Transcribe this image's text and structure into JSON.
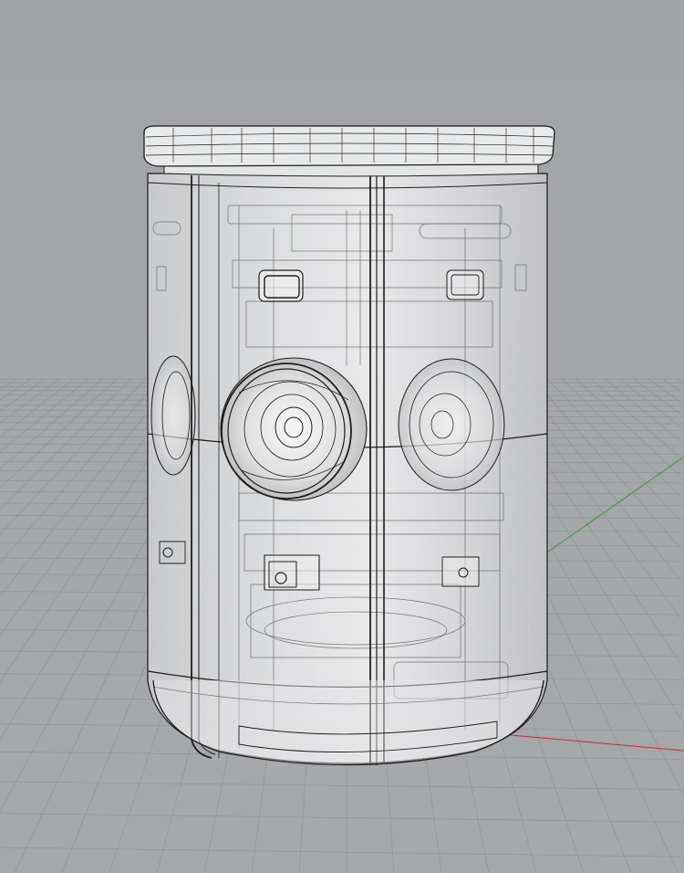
{
  "viewport": {
    "background_color": "#a4a6a9",
    "grid_color": "#8f9194",
    "axis_x_color": "#c83232",
    "axis_y_color": "#3a9a3a",
    "wire_color": "#1e1e1e",
    "ghost_fill": "#ffffff"
  },
  "model": {
    "shading_mode": "ghosted",
    "components": [
      "top-cap",
      "cylindrical-shell",
      "front-seam-strip-left",
      "front-seam-strip-right",
      "center-speaker",
      "right-speaker",
      "left-speaker",
      "upper-slot-left",
      "upper-slot-right",
      "lower-port-left",
      "lower-port-right",
      "base-cap"
    ]
  }
}
